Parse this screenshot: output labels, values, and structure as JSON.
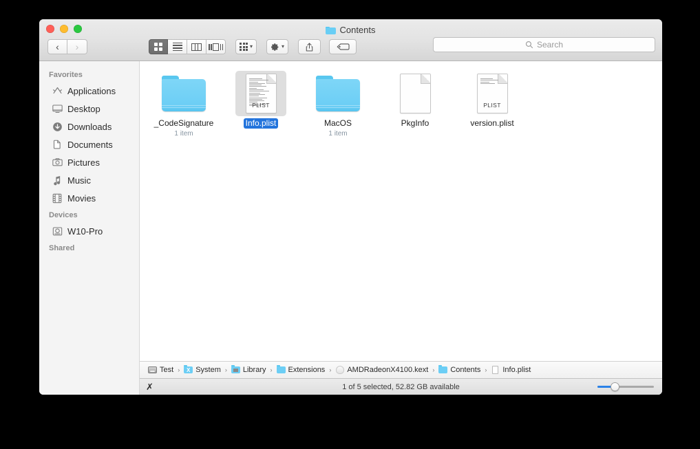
{
  "window": {
    "title": "Contents",
    "title_icon": "folder-icon",
    "traffic_lights": [
      {
        "name": "close",
        "color": "#ff5f57"
      },
      {
        "name": "minimize",
        "color": "#febc2e"
      },
      {
        "name": "zoom",
        "color": "#2ac840"
      }
    ]
  },
  "toolbar": {
    "back_label": "‹",
    "forward_label": "›",
    "view_modes": [
      {
        "name": "icon-view",
        "active": true
      },
      {
        "name": "list-view",
        "active": false
      },
      {
        "name": "column-view",
        "active": false
      },
      {
        "name": "coverflow-view",
        "active": false
      }
    ],
    "arrange_caret": "▾",
    "action_caret": "▾"
  },
  "search": {
    "placeholder": "Search",
    "value": "",
    "icon": "search-icon"
  },
  "sidebar": {
    "sections": [
      {
        "header": "Favorites",
        "items": [
          {
            "label": "Applications",
            "icon": "applications-icon"
          },
          {
            "label": "Desktop",
            "icon": "desktop-icon"
          },
          {
            "label": "Downloads",
            "icon": "downloads-icon"
          },
          {
            "label": "Documents",
            "icon": "documents-icon"
          },
          {
            "label": "Pictures",
            "icon": "pictures-icon"
          },
          {
            "label": "Music",
            "icon": "music-icon"
          },
          {
            "label": "Movies",
            "icon": "movies-icon"
          }
        ]
      },
      {
        "header": "Devices",
        "items": [
          {
            "label": "W10-Pro",
            "icon": "harddisk-icon"
          }
        ]
      },
      {
        "header": "Shared",
        "items": []
      }
    ]
  },
  "files": [
    {
      "name": "_CodeSignature",
      "kind": "folder",
      "subtitle": "1 item",
      "selected": false
    },
    {
      "name": "Info.plist",
      "kind": "plist",
      "badge": "PLIST",
      "subtitle": "",
      "selected": true
    },
    {
      "name": "MacOS",
      "kind": "folder",
      "subtitle": "1 item",
      "selected": false
    },
    {
      "name": "PkgInfo",
      "kind": "document",
      "badge": "",
      "subtitle": "",
      "selected": false
    },
    {
      "name": "version.plist",
      "kind": "plist",
      "badge": "PLIST",
      "subtitle": "",
      "selected": false
    }
  ],
  "pathbar": {
    "separator": "›",
    "crumbs": [
      {
        "label": "Test",
        "icon": "harddisk-icon"
      },
      {
        "label": "System",
        "icon": "system-folder-icon"
      },
      {
        "label": "Library",
        "icon": "library-folder-icon"
      },
      {
        "label": "Extensions",
        "icon": "folder-icon"
      },
      {
        "label": "AMDRadeonX4100.kext",
        "icon": "kext-icon"
      },
      {
        "label": "Contents",
        "icon": "folder-icon"
      },
      {
        "label": "Info.plist",
        "icon": "document-icon"
      }
    ]
  },
  "statusbar": {
    "left_glyph": "✗",
    "text": "1 of 5 selected, 52.82 GB available",
    "zoom_percent": 25
  },
  "colors": {
    "selection_blue": "#2374dc",
    "folder_blue": "#6ccef5",
    "slider_blue": "#2b82e8",
    "subtitle_gray": "#8795a1"
  }
}
